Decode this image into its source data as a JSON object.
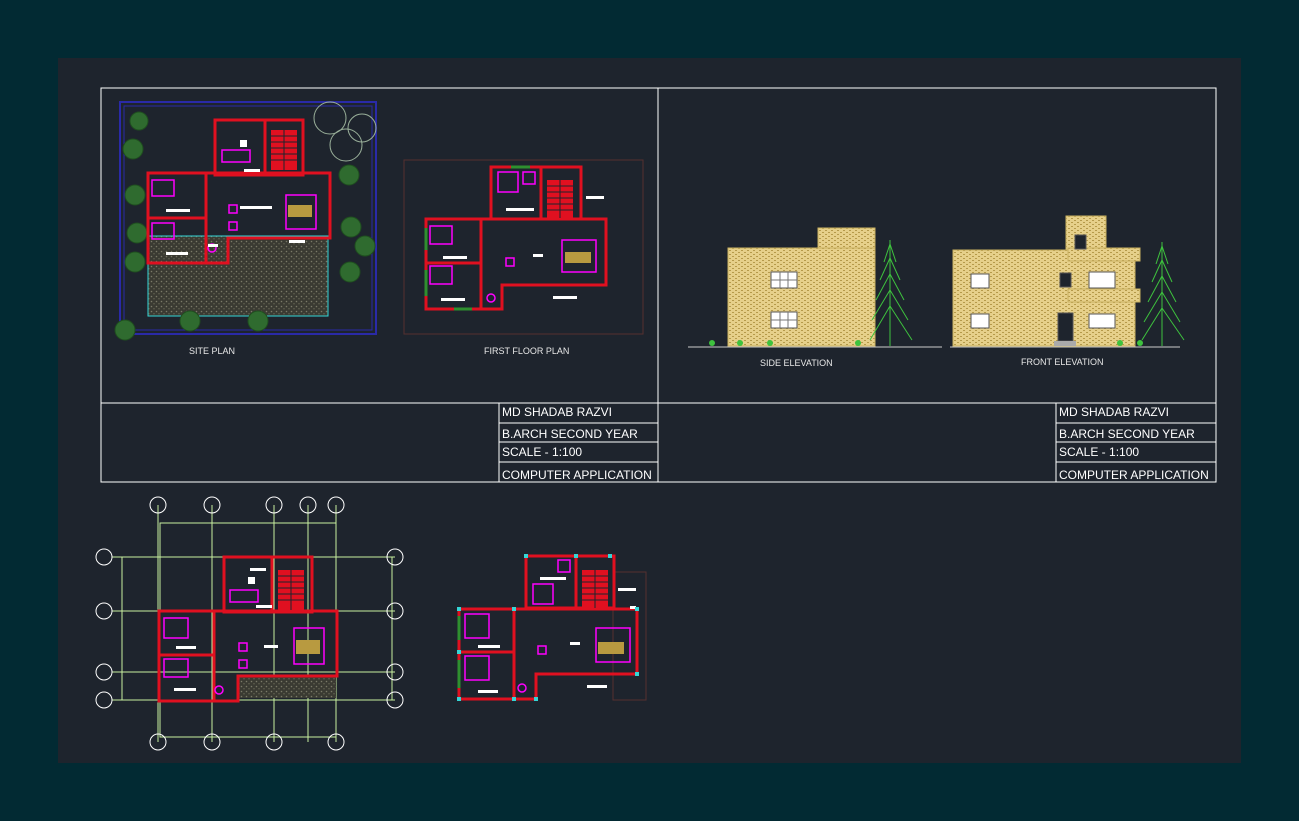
{
  "sheet": {
    "labels": {
      "site_plan": "SITE  PLAN",
      "first_floor_plan": "FIRST  FLOOR  PLAN",
      "side_elevation": "SIDE ELEVATION",
      "front_elevation": "FRONT ELEVATION"
    },
    "title_block_left": {
      "name": "MD SHADAB RAZVI",
      "course": "B.ARCH SECOND YEAR",
      "scale": "SCALE - 1:100",
      "subject": "COMPUTER APPLICATION"
    },
    "title_block_right": {
      "name": "MD SHADAB RAZVI",
      "course": "B.ARCH SECOND YEAR",
      "scale": "SCALE - 1:100",
      "subject": "COMPUTER APPLICATION"
    }
  },
  "colors": {
    "background_outer": "#022a33",
    "model_space": "#1e242d",
    "frame": "#ffffff",
    "wall": "#e01020",
    "furniture": "#ff00ff",
    "boundary": "#2a2aa8",
    "lawn": "#34d6d6",
    "tree": "#2f6b2f",
    "brick": "#e8d38a",
    "grid": "#c8f0a0"
  }
}
